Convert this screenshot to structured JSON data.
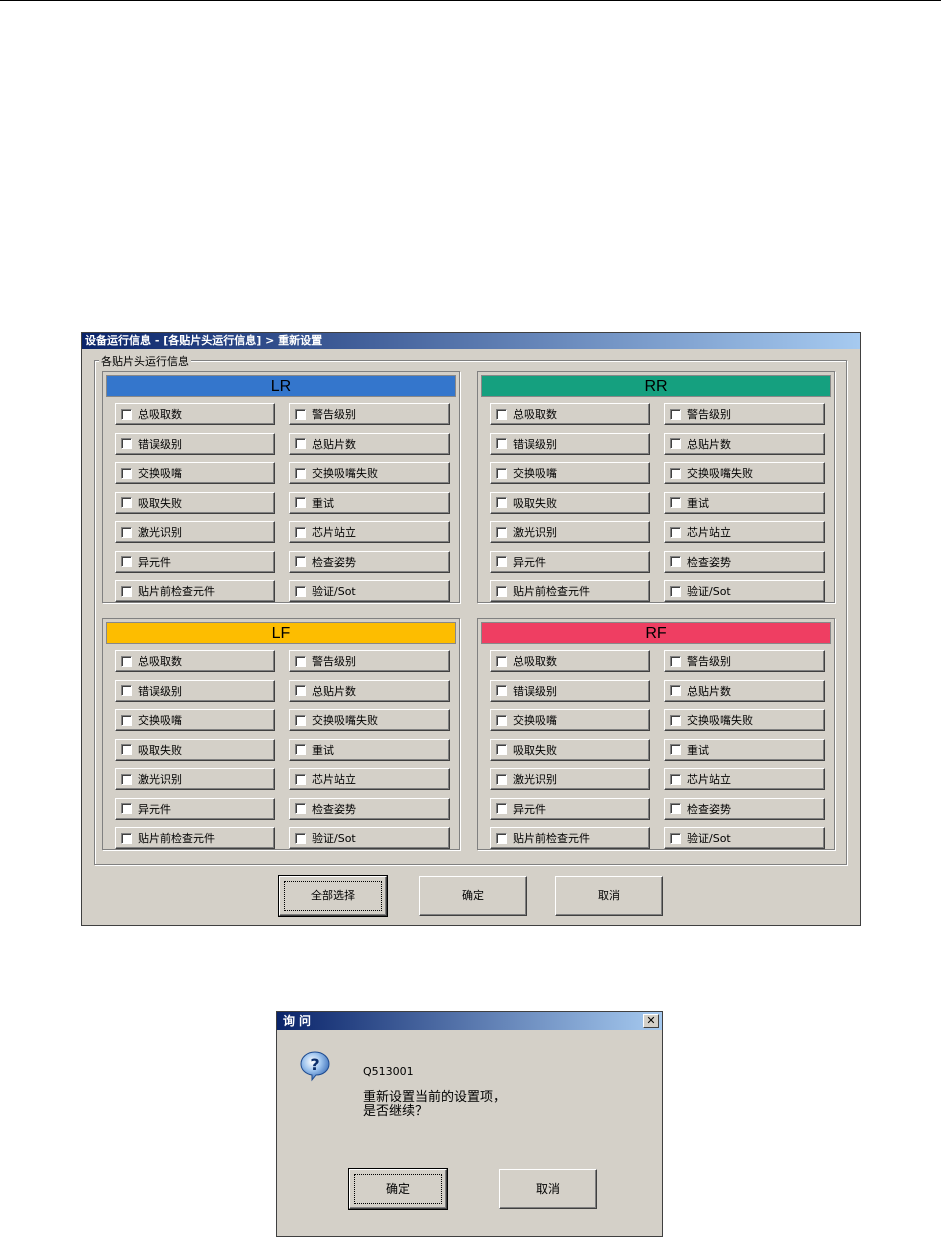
{
  "window": {
    "title": "设备运行信息 - [各贴片头运行信息] > 重新设置",
    "group_label": "各贴片头运行信息",
    "panels": [
      {
        "name": "LR",
        "color": "#3476cc"
      },
      {
        "name": "RR",
        "color": "#15a07f"
      },
      {
        "name": "LF",
        "color": "#fdbd00"
      },
      {
        "name": "RF",
        "color": "#ef3e62"
      }
    ],
    "checkbox_labels": [
      "总吸取数",
      "警告级别",
      "错误级别",
      "总贴片数",
      "交换吸嘴",
      "交换吸嘴失败",
      "吸取失败",
      "重试",
      "激光识别",
      "芯片站立",
      "异元件",
      "检查姿势",
      "贴片前检查元件",
      "验证/Sot"
    ],
    "buttons": {
      "select_all": "全部选择",
      "ok": "确定",
      "cancel": "取消"
    }
  },
  "dialog": {
    "title": "询问",
    "close_glyph": "✕",
    "icon": "question-icon",
    "code": "Q513001",
    "message_line1": "重新设置当前的设置项，",
    "message_line2": "是否继续？",
    "buttons": {
      "ok": "确定",
      "cancel": "取消"
    }
  }
}
